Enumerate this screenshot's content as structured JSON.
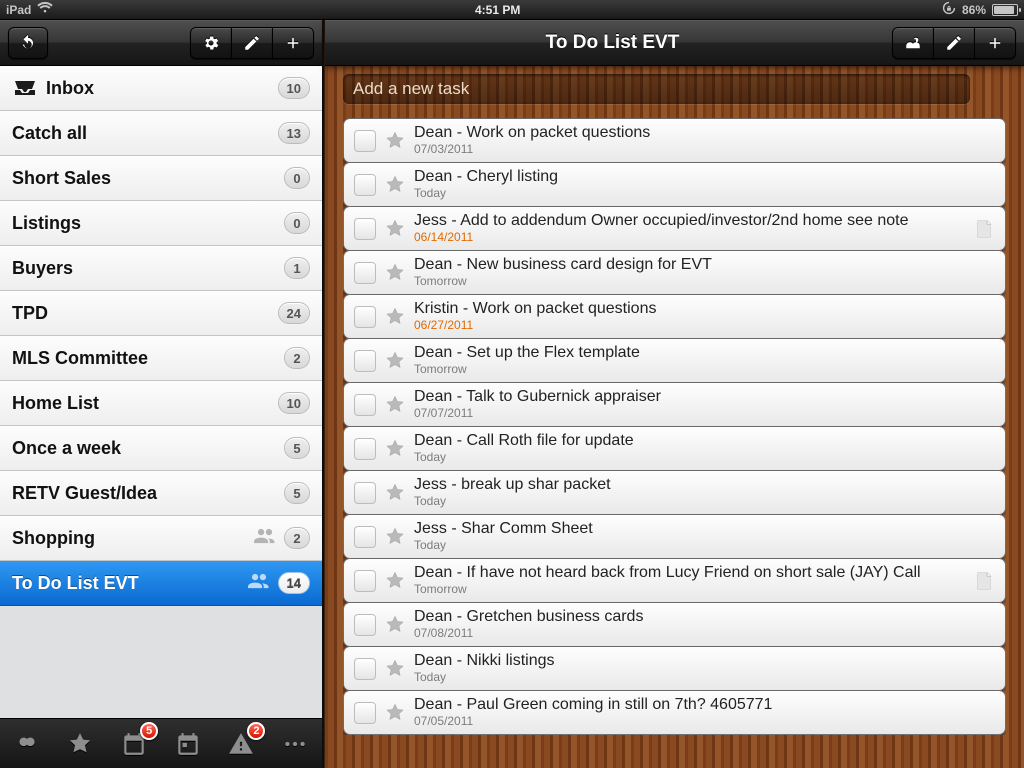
{
  "statusbar": {
    "device": "iPad",
    "time": "4:51 PM",
    "battery_pct": "86%"
  },
  "sidebar": {
    "lists": [
      {
        "name": "Inbox",
        "count": "10",
        "shared": false,
        "icon": "inbox"
      },
      {
        "name": "Catch all",
        "count": "13",
        "shared": false
      },
      {
        "name": "Short Sales",
        "count": "0",
        "shared": false
      },
      {
        "name": "Listings",
        "count": "0",
        "shared": false
      },
      {
        "name": "Buyers",
        "count": "1",
        "shared": false
      },
      {
        "name": "TPD",
        "count": "24",
        "shared": false
      },
      {
        "name": "MLS Committee",
        "count": "2",
        "shared": false
      },
      {
        "name": "Home List",
        "count": "10",
        "shared": false
      },
      {
        "name": "Once a week",
        "count": "5",
        "shared": false
      },
      {
        "name": "RETV Guest/Idea",
        "count": "5",
        "shared": false
      },
      {
        "name": "Shopping",
        "count": "2",
        "shared": true
      },
      {
        "name": "To Do List EVT",
        "count": "14",
        "shared": true,
        "selected": true
      }
    ],
    "tabs": {
      "calendar_badge": "5",
      "alert_badge": "2"
    }
  },
  "main": {
    "title": "To Do List EVT",
    "add_placeholder": "Add a new task",
    "tasks": [
      {
        "title": "Dean - Work on packet questions",
        "due": "07/03/2011",
        "overdue": false,
        "note": false
      },
      {
        "title": "Dean - Cheryl listing",
        "due": "Today",
        "overdue": false,
        "note": false
      },
      {
        "title": "Jess - Add to addendum Owner occupied/investor/2nd home see note",
        "due": "06/14/2011",
        "overdue": true,
        "note": true
      },
      {
        "title": "Dean - New business card design for EVT",
        "due": "Tomorrow",
        "overdue": false,
        "note": false
      },
      {
        "title": "Kristin - Work on packet questions",
        "due": "06/27/2011",
        "overdue": true,
        "note": false
      },
      {
        "title": "Dean - Set up the Flex template",
        "due": "Tomorrow",
        "overdue": false,
        "note": false
      },
      {
        "title": "Dean - Talk to Gubernick appraiser",
        "due": "07/07/2011",
        "overdue": false,
        "note": false
      },
      {
        "title": "Dean - Call Roth file for update",
        "due": "Today",
        "overdue": false,
        "note": false
      },
      {
        "title": "Jess - break up shar packet",
        "due": "Today",
        "overdue": false,
        "note": false
      },
      {
        "title": "Jess - Shar Comm Sheet",
        "due": "Today",
        "overdue": false,
        "note": false
      },
      {
        "title": "Dean - If have not heard back from Lucy Friend on short sale (JAY) Call",
        "due": "Tomorrow",
        "overdue": false,
        "note": true
      },
      {
        "title": "Dean - Gretchen business cards",
        "due": "07/08/2011",
        "overdue": false,
        "note": false
      },
      {
        "title": "Dean - Nikki listings",
        "due": "Today",
        "overdue": false,
        "note": false
      },
      {
        "title": "Dean - Paul Green coming in still on 7th? 4605771",
        "due": "07/05/2011",
        "overdue": false,
        "note": false
      }
    ]
  }
}
